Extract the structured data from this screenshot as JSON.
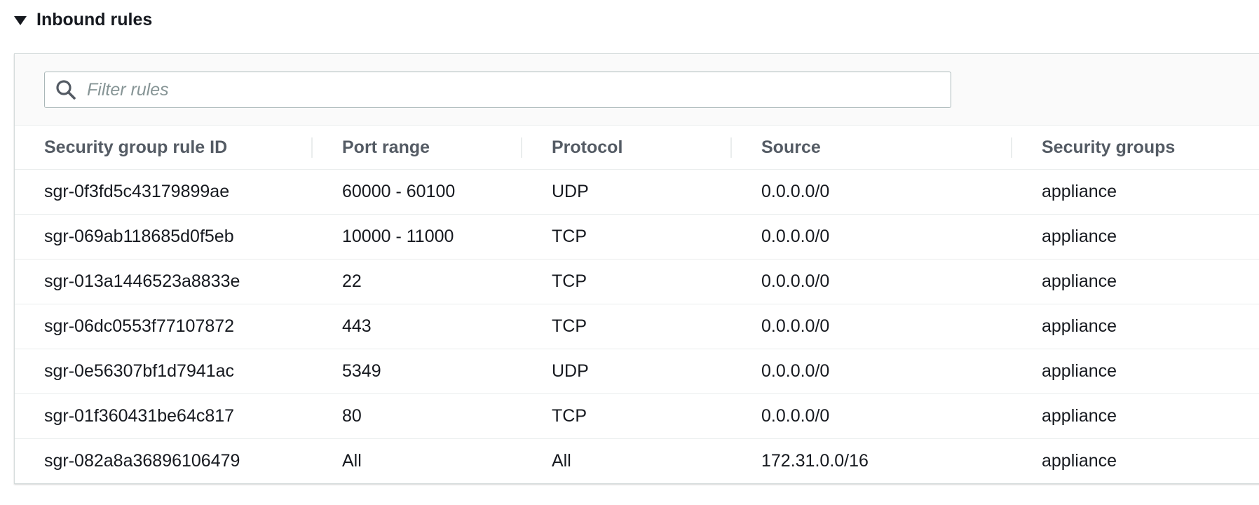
{
  "section": {
    "title": "Inbound rules"
  },
  "filter": {
    "placeholder": "Filter rules",
    "value": ""
  },
  "table": {
    "columns": [
      "Security group rule ID",
      "Port range",
      "Protocol",
      "Source",
      "Security groups"
    ],
    "rows": [
      [
        "sgr-0f3fd5c43179899ae",
        "60000 - 60100",
        "UDP",
        "0.0.0.0/0",
        "appliance"
      ],
      [
        "sgr-069ab118685d0f5eb",
        "10000 - 11000",
        "TCP",
        "0.0.0.0/0",
        "appliance"
      ],
      [
        "sgr-013a1446523a8833e",
        "22",
        "TCP",
        "0.0.0.0/0",
        "appliance"
      ],
      [
        "sgr-06dc0553f77107872",
        "443",
        "TCP",
        "0.0.0.0/0",
        "appliance"
      ],
      [
        "sgr-0e56307bf1d7941ac",
        "5349",
        "UDP",
        "0.0.0.0/0",
        "appliance"
      ],
      [
        "sgr-01f360431be64c817",
        "80",
        "TCP",
        "0.0.0.0/0",
        "appliance"
      ],
      [
        "sgr-082a8a36896106479",
        "All",
        "All",
        "172.31.0.0/16",
        "appliance"
      ]
    ]
  },
  "icons": {
    "collapse": "caret-down-icon",
    "search": "search-icon"
  },
  "colors": {
    "text": "#16191f",
    "header_text": "#545b64",
    "border": "#eaeded",
    "placeholder": "#879596"
  }
}
